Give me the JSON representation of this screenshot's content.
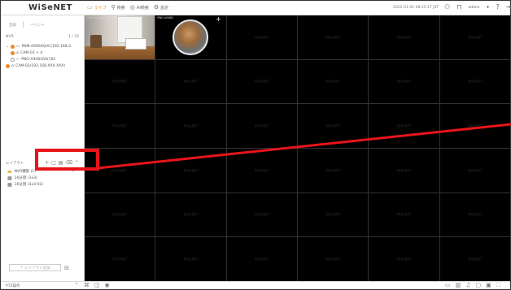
{
  "app": {
    "logo": "WiSeNET"
  },
  "topbar": {
    "tabs": [
      {
        "label": "ライブ",
        "icon": "monitor-icon",
        "active": true
      },
      {
        "label": "検索",
        "icon": "search-icon",
        "active": false
      },
      {
        "label": "AI検索",
        "icon": "ai-search-icon",
        "active": false
      },
      {
        "label": "設定",
        "icon": "gear-icon",
        "active": false
      }
    ],
    "datetime": "2022-01-05 08:25:17 JST",
    "user": "admin"
  },
  "left_panel": {
    "top_tabs": [
      "登録",
      "イベント"
    ],
    "device_header": "NVR",
    "device_header_count": "1 / 32",
    "tree": [
      {
        "label": "PNM-A9000QVC(192.168.0.",
        "status": "online"
      },
      {
        "label": "CAM-01 + 4",
        "status": "online"
      },
      {
        "label": "PNO-A9081RA(192",
        "status": "offline"
      },
      {
        "label": "CAM-02(192.168.XXX.XXX)",
        "status": "online"
      }
    ],
    "layout_header": "レイアウト",
    "layouts": [
      {
        "label": "NVR撮影 (1)",
        "highlight": true
      },
      {
        "label": "16分割 (3x3)"
      },
      {
        "label": "16分割 (3x3-02)"
      }
    ],
    "bottom_button": "レイアウト追加"
  },
  "grid": {
    "watermark": "WiSeNET",
    "cam1_label": "CAM-01 (192.168.1)",
    "cam2_label": "PNO-A9081"
  },
  "bottombar": {
    "left_label": "PTZ操作"
  },
  "colors": {
    "accent": "#f08a24",
    "highlight": "#e8141a"
  }
}
